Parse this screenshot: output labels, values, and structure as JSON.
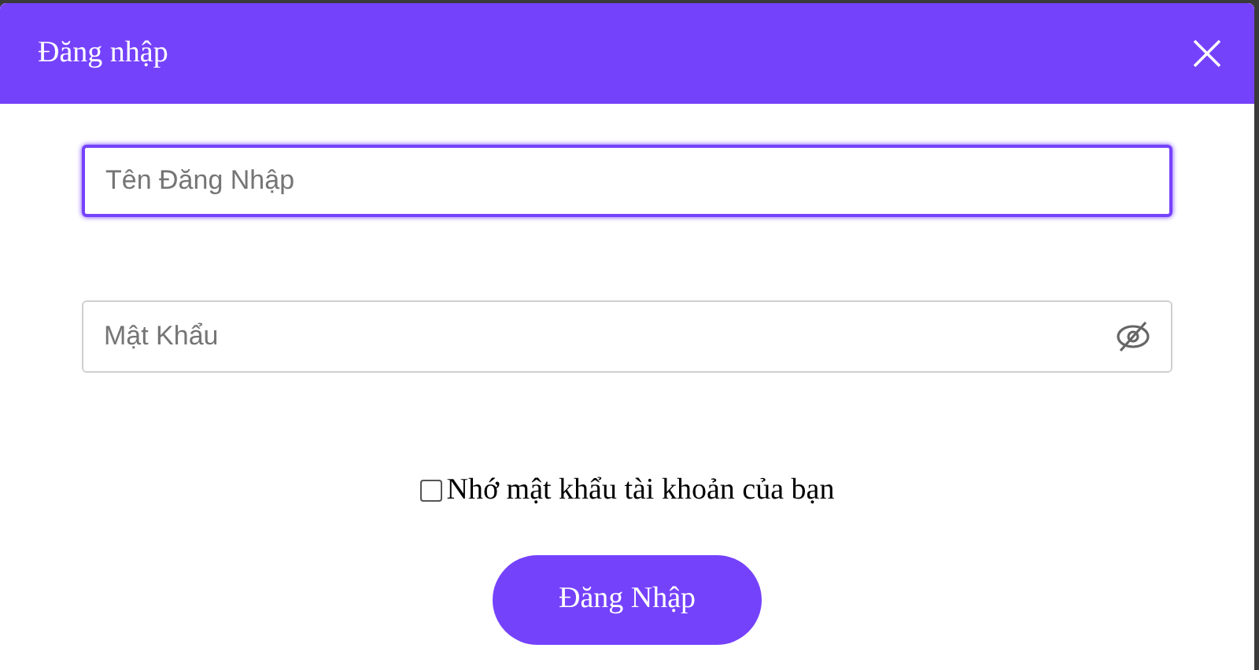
{
  "dialog": {
    "title": "Đăng nhập"
  },
  "fields": [
    {
      "kind": "text",
      "placeholder": "Tên Đăng Nhập",
      "focused": true
    },
    {
      "kind": "password",
      "placeholder": "Mật Khẩu",
      "focused": false
    }
  ],
  "remember": {
    "label": "Nhớ mật khẩu tài khoản của bạn",
    "checked": false
  },
  "submit": {
    "label": "Đăng Nhập"
  }
}
